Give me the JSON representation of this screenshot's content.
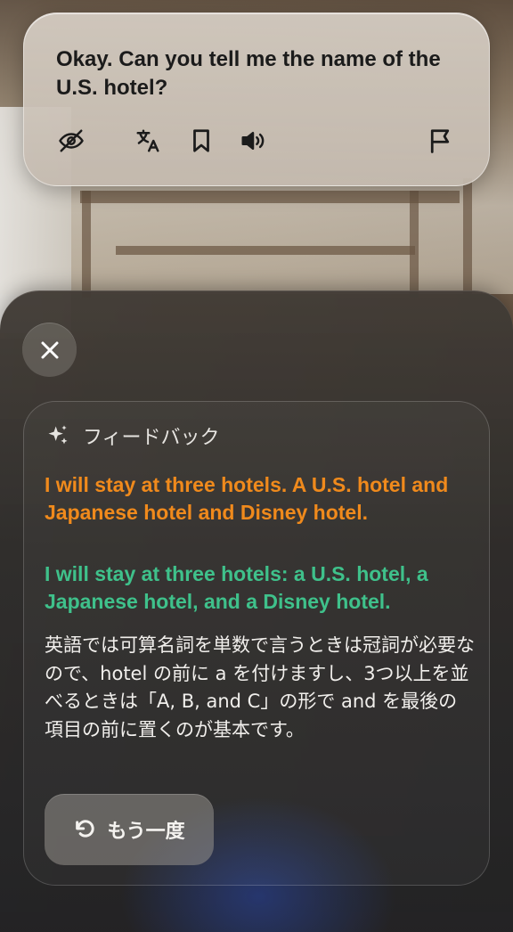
{
  "prompt": {
    "text": "Okay. Can you tell me the name of the U.S. hotel?",
    "actions": [
      {
        "name": "hide-icon"
      },
      {
        "name": "translate-icon"
      },
      {
        "name": "bookmark-icon"
      },
      {
        "name": "speaker-icon"
      },
      {
        "name": "flag-icon"
      }
    ]
  },
  "feedback": {
    "title": "フィードバック",
    "original": "I will stay at three hotels. A U.S. hotel and Japanese hotel and Disney hotel.",
    "corrected": "I will stay at three hotels: a U.S. hotel, a Japanese hotel, and a Disney hotel.",
    "explanation": "英語では可算名詞を単数で言うときは冠詞が必要なので、hotel の前に a を付けますし、3つ以上を並べるときは「A, B, and C」の形で and を最後の項目の前に置くのが基本です。",
    "retry_label": "もう一度"
  },
  "colors": {
    "original": "#f08a1c",
    "corrected": "#3fc18b"
  }
}
